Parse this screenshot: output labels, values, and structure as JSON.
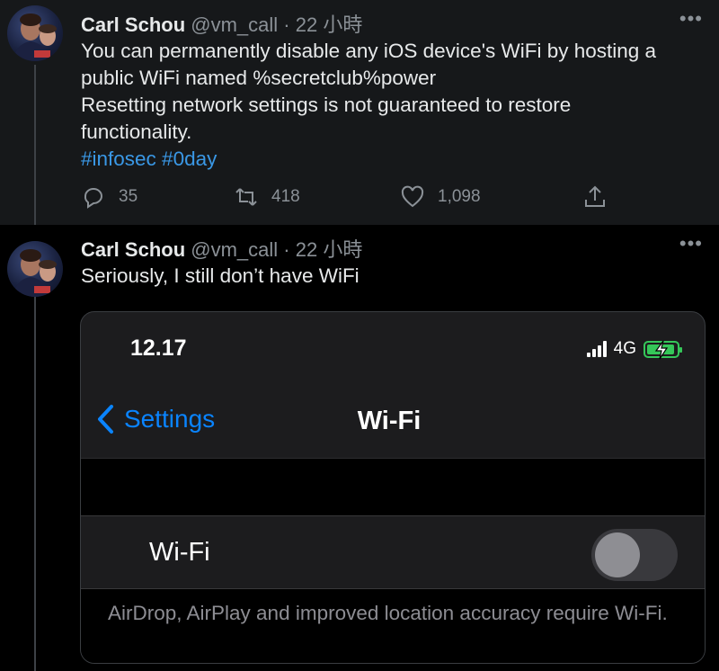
{
  "tweets": [
    {
      "author_name": "Carl Schou",
      "handle": "@vm_call",
      "separator": "·",
      "time": "22 小時",
      "more": "•••",
      "lines": [
        "You can permanently disable any iOS device's WiFi by hosting a",
        "public WiFi named %secretclub%power",
        "Resetting network settings is not guaranteed to restore",
        "functionality."
      ],
      "hashtags": "#infosec #0day",
      "replies": "35",
      "retweets": "418",
      "likes": "1,098"
    },
    {
      "author_name": "Carl Schou",
      "handle": "@vm_call",
      "separator": "·",
      "time": "22 小時",
      "more": "•••",
      "text": "Seriously, I still don’t have WiFi"
    }
  ],
  "embedded_screenshot": {
    "clock": "12.17",
    "network": "4G",
    "back_label": "Settings",
    "nav_title": "Wi-Fi",
    "row_label": "Wi-Fi",
    "toggle_on": false,
    "footer": "AirDrop, AirPlay and improved location accuracy require Wi-Fi."
  },
  "colors": {
    "accent": "#3a98e6",
    "ios_blue": "#0a84ff",
    "battery_green": "#35c759",
    "muted": "#8b9197"
  },
  "icons": [
    "reply-icon",
    "retweet-icon",
    "like-icon",
    "share-icon",
    "chevron-left-icon",
    "signal-icon",
    "battery-charging-icon",
    "more-icon"
  ]
}
